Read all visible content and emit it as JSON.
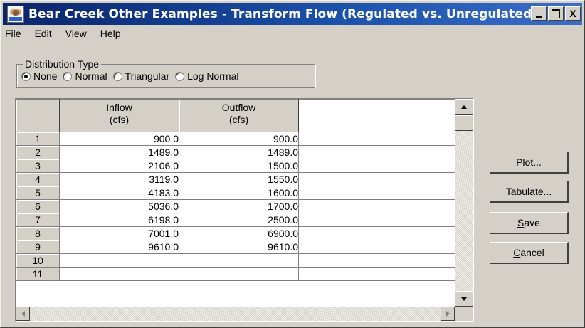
{
  "window": {
    "title": "Bear Creek Other Examples - Transform Flow (Regulated vs. Unregulated)",
    "icon": "hec-ressim-app-icon",
    "caption_buttons": [
      "minimize",
      "maximize",
      "close"
    ],
    "close_glyph": "X"
  },
  "menu": [
    "File",
    "Edit",
    "View",
    "Help"
  ],
  "distribution": {
    "legend": "Distribution Type",
    "options": [
      {
        "label": "None",
        "checked": true
      },
      {
        "label": "Normal",
        "checked": false
      },
      {
        "label": "Triangular",
        "checked": false
      },
      {
        "label": "Log Normal",
        "checked": false
      }
    ]
  },
  "grid": {
    "columns": [
      {
        "name": "Inflow",
        "unit": "(cfs)"
      },
      {
        "name": "Outflow",
        "unit": "(cfs)"
      }
    ],
    "rows": [
      {
        "n": "1",
        "inflow": "900.0",
        "outflow": "900.0"
      },
      {
        "n": "2",
        "inflow": "1489.0",
        "outflow": "1489.0"
      },
      {
        "n": "3",
        "inflow": "2106.0",
        "outflow": "1500.0"
      },
      {
        "n": "4",
        "inflow": "3119.0",
        "outflow": "1550.0"
      },
      {
        "n": "5",
        "inflow": "4183.0",
        "outflow": "1600.0"
      },
      {
        "n": "6",
        "inflow": "5036.0",
        "outflow": "1700.0"
      },
      {
        "n": "7",
        "inflow": "6198.0",
        "outflow": "2500.0"
      },
      {
        "n": "8",
        "inflow": "7001.0",
        "outflow": "6900.0"
      },
      {
        "n": "9",
        "inflow": "9610.0",
        "outflow": "9610.0"
      },
      {
        "n": "10",
        "inflow": "",
        "outflow": ""
      },
      {
        "n": "11",
        "inflow": "",
        "outflow": ""
      }
    ]
  },
  "buttons": {
    "plot": "Plot...",
    "tabulate": "Tabulate...",
    "save_prefix": "S",
    "save_rest": "ave",
    "cancel_prefix": "C",
    "cancel_rest": "ancel"
  },
  "colors": {
    "titlebar_start": "#0a246a",
    "titlebar_end": "#3a6ec8",
    "face": "#d4d0c8"
  }
}
